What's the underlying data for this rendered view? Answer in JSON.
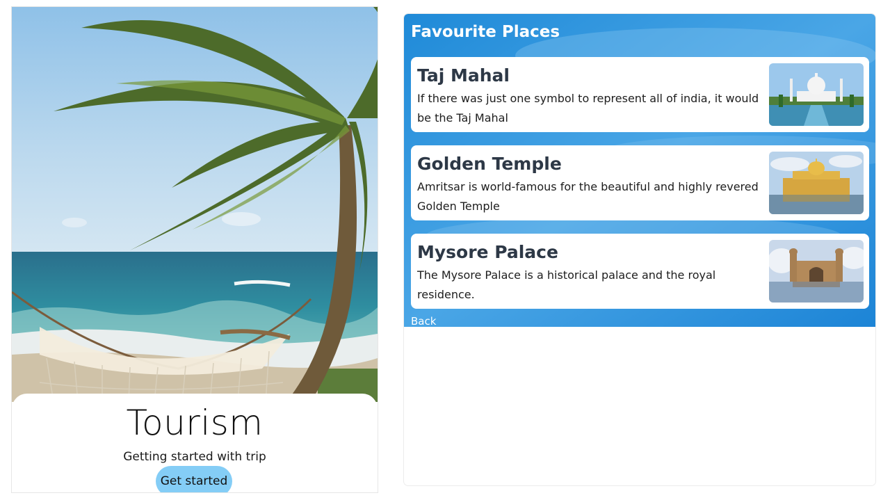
{
  "welcome": {
    "title": "Tourism",
    "subtitle": "Getting started with trip",
    "button_label": "Get started",
    "button_color": "#84cdf6"
  },
  "places_screen": {
    "title": "Favourite Places",
    "back_label": "Back",
    "panel_color": "#1e8fe0",
    "places": [
      {
        "name": "Taj Mahal",
        "description": "If there was just one symbol to represent all of india, it would be the Taj Mahal",
        "image_icon": "taj-mahal-photo"
      },
      {
        "name": "Golden Temple",
        "description": "Amritsar is world-famous for the beautiful and highly revered Golden Temple",
        "image_icon": "golden-temple-photo"
      },
      {
        "name": "Mysore Palace",
        "description": "The Mysore Palace is a historical palace and the royal residence.",
        "image_icon": "mysore-palace-photo"
      }
    ]
  }
}
